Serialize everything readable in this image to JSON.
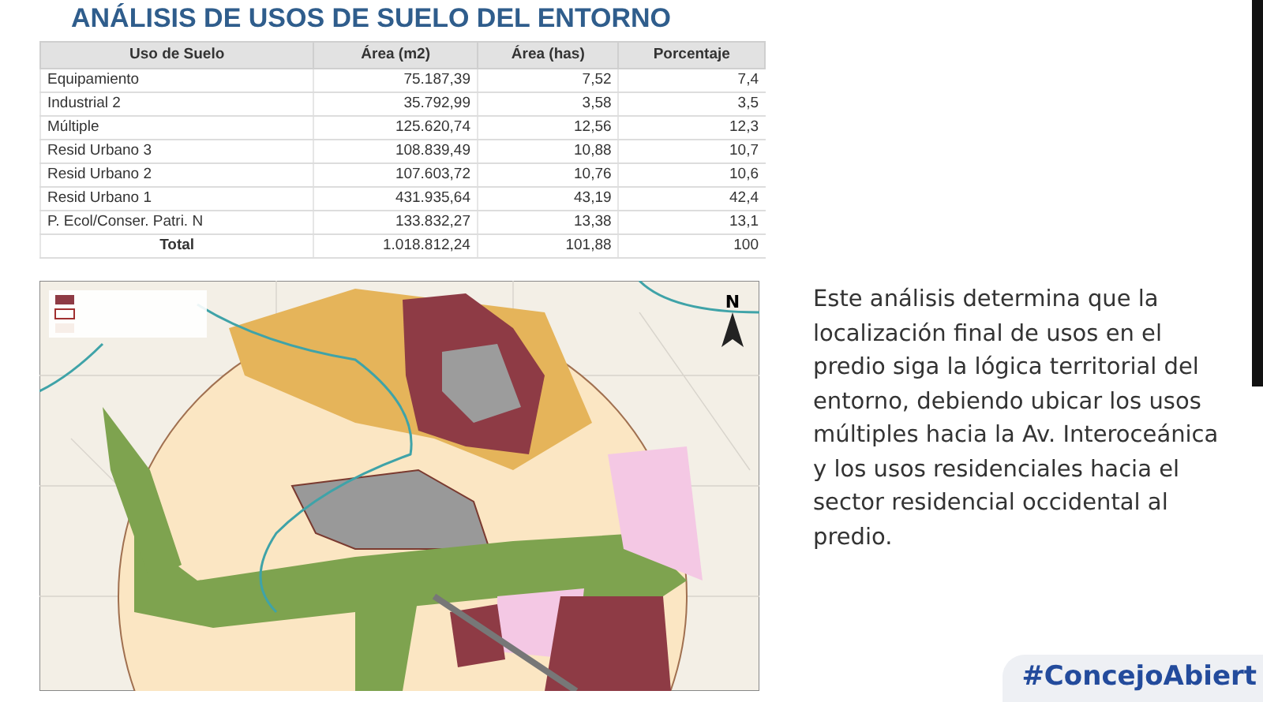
{
  "title": "ANÁLISIS DE USOS DE SUELO DEL ENTORNO",
  "table": {
    "columns": [
      "Uso de Suelo",
      "Área (m2)",
      "Área (has)",
      "Porcentaje"
    ],
    "rows": [
      [
        "Equipamiento",
        "75.187,39",
        "7,52",
        "7,4"
      ],
      [
        "Industrial 2",
        "35.792,99",
        "3,58",
        "3,5"
      ],
      [
        "Múltiple",
        "125.620,74",
        "12,56",
        "12,3"
      ],
      [
        "Resid Urbano 3",
        "108.839,49",
        "10,88",
        "10,7"
      ],
      [
        "Resid Urbano 2",
        "107.603,72",
        "10,76",
        "10,6"
      ],
      [
        "Resid Urbano 1",
        "431.935,64",
        "43,19",
        "42,4"
      ],
      [
        "P. Ecol/Conser. Patri. N",
        "133.832,27",
        "13,38",
        "13,1"
      ]
    ],
    "total": [
      "Total",
      "1.018.812,24",
      "101,88",
      "100"
    ]
  },
  "map": {
    "north_label": "N"
  },
  "description": "Este análisis determina que la localización final de usos en el predio siga la lógica territorial del entorno, debiendo ubicar los usos múltiples hacia la Av. Interoceánica y los usos residenciales hacia el sector residencial occidental al predio.",
  "hashtag": "#ConcejoAbiert"
}
